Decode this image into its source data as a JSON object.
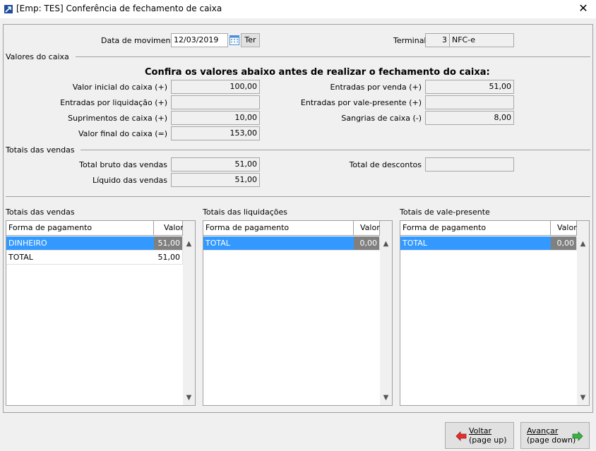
{
  "window": {
    "title": "[Emp: TES] Conferência de fechamento de caixa",
    "close": "✕"
  },
  "header": {
    "data_label": "Data de movimento",
    "data_value": "12/03/2019",
    "calendar_icon": "calendar-icon",
    "day_button": "Ter",
    "terminal_label": "Terminal",
    "terminal_number": "3",
    "terminal_name": "NFC-e"
  },
  "valores": {
    "section_label": "Valores do caixa",
    "heading": "Confira os valores abaixo antes de realizar o fechamento do caixa:",
    "valor_inicial_label": "Valor inicial do caixa (+)",
    "valor_inicial": "100,00",
    "entradas_liquidacao_label": "Entradas por liquidação (+)",
    "entradas_liquidacao": "",
    "suprimentos_label": "Suprimentos de caixa (+)",
    "suprimentos": "10,00",
    "valor_final_label": "Valor final do caixa (=)",
    "valor_final": "153,00",
    "entradas_venda_label": "Entradas por venda (+)",
    "entradas_venda": "51,00",
    "entradas_vale_label": "Entradas por vale-presente (+)",
    "entradas_vale": "",
    "sangrias_label": "Sangrias de caixa (-)",
    "sangrias": "8,00"
  },
  "totais": {
    "section_label": "Totais das vendas",
    "total_bruto_label": "Total bruto das vendas",
    "total_bruto": "51,00",
    "liquido_label": "Líquido das vendas",
    "liquido": "51,00",
    "total_descontos_label": "Total de descontos",
    "total_descontos": ""
  },
  "grids": {
    "vendas": {
      "title": "Totais das vendas",
      "col_forma": "Forma de pagamento",
      "col_valor": "Valor",
      "rows": [
        {
          "forma": "DINHEIRO",
          "valor": "51,00"
        },
        {
          "forma": "TOTAL",
          "valor": "51,00"
        }
      ]
    },
    "liquidacoes": {
      "title": "Totais das liquidações",
      "col_forma": "Forma de pagamento",
      "col_valor": "Valor",
      "rows": [
        {
          "forma": "TOTAL",
          "valor": "0,00"
        }
      ]
    },
    "vale": {
      "title": "Totais de vale-presente",
      "col_forma": "Forma de pagamento",
      "col_valor": "Valor",
      "rows": [
        {
          "forma": "TOTAL",
          "valor": "0,00"
        }
      ]
    }
  },
  "buttons": {
    "voltar_line1": "Voltar",
    "voltar_line2": "(page up)",
    "avancar_line1": "Avançar",
    "avancar_line2": "(page down)"
  },
  "colors": {
    "selection": "#3399ff",
    "selected_value": "#808080",
    "arrow_back": "#e03030",
    "arrow_forward": "#3cb043"
  }
}
